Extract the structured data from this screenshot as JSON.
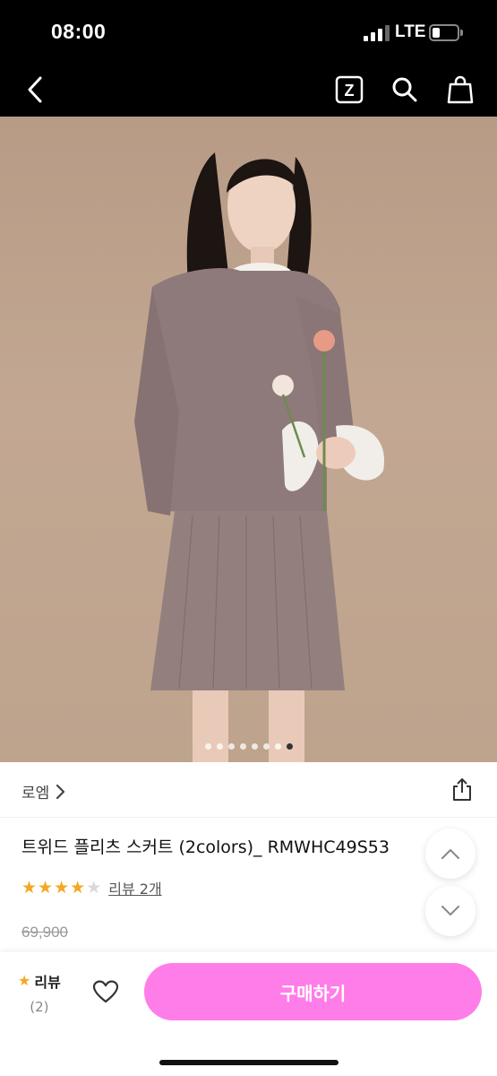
{
  "status_bar": {
    "time": "08:00",
    "network": "LTE",
    "battery_level": 0.3
  },
  "nav": {
    "icons": [
      "back-icon",
      "z-logo-icon",
      "search-icon",
      "shopping-bag-icon"
    ],
    "z_label": "Z"
  },
  "carousel": {
    "total": 8,
    "active_index": 7,
    "colors": {
      "active": "#333333",
      "inactive": "#ffffff"
    }
  },
  "brand": {
    "name": "로엠"
  },
  "product": {
    "title": "트위드 플리츠 스커트 (2colors)_ RMWHC49S53",
    "rating": 4,
    "max_rating": 5,
    "review_link": "리뷰 2개",
    "original_price": "69,900"
  },
  "bottom_bar": {
    "review_label": "리뷰",
    "review_count": "(2)",
    "buy_label": "구매하기",
    "buy_color": "#ff7de8"
  },
  "colors": {
    "star": "#f5a623",
    "header": "#000000"
  }
}
